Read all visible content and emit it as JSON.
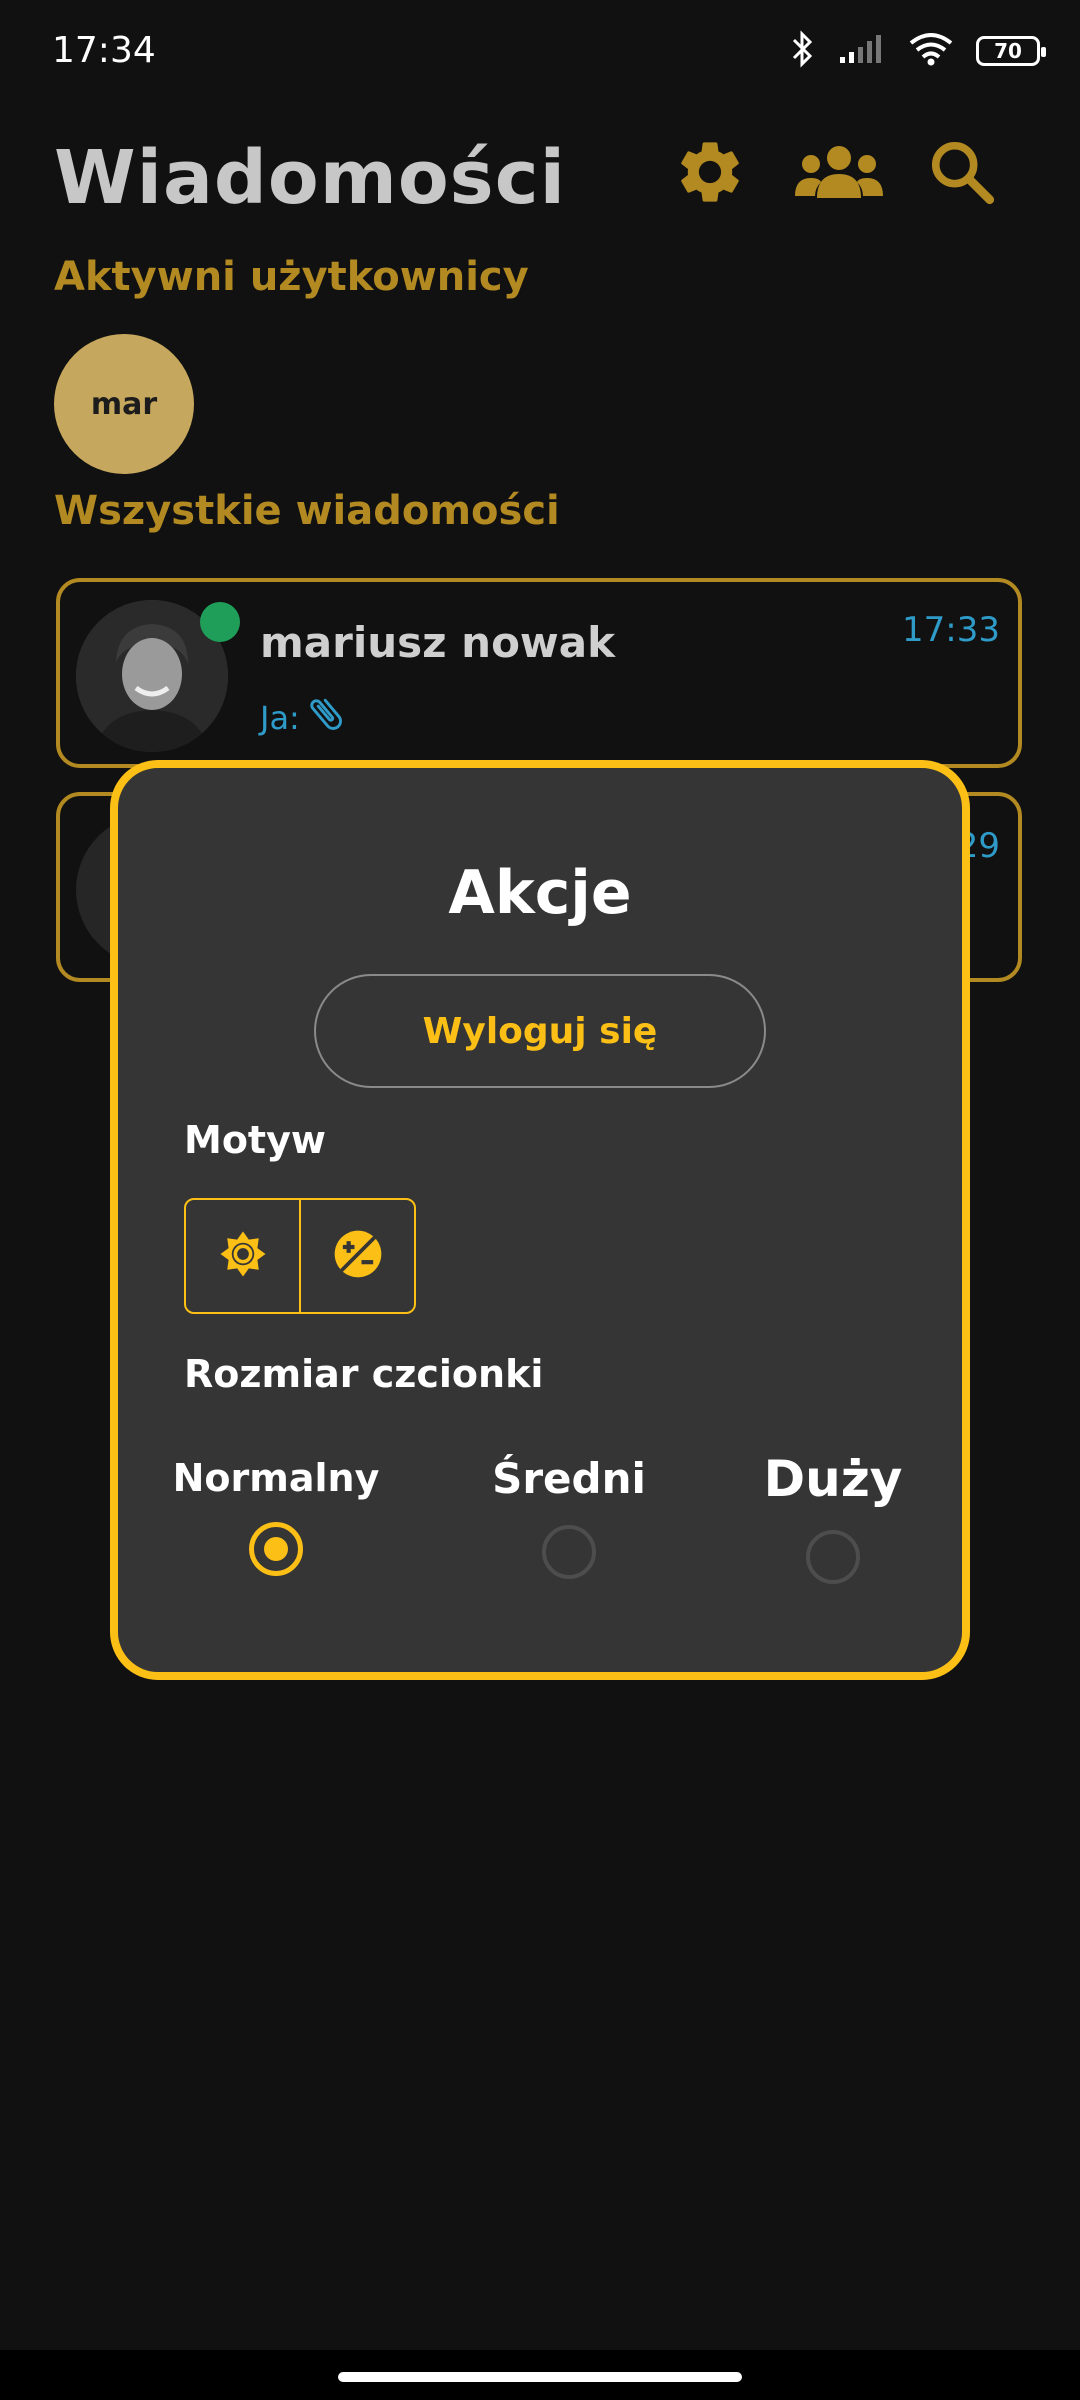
{
  "status_bar": {
    "time": "17:34",
    "battery": "70",
    "icons": [
      "bluetooth-icon",
      "signal-icon",
      "wifi-icon",
      "battery-icon"
    ]
  },
  "header": {
    "title": "Wiadomości",
    "icons": [
      "settings-gear-icon",
      "users-group-icon",
      "search-icon"
    ]
  },
  "active_users": {
    "title": "Aktywni użytkownicy",
    "users": [
      {
        "initials": "mar"
      }
    ]
  },
  "all_messages": {
    "title": "Wszystkie wiadomości",
    "chats": [
      {
        "name": "mariusz nowak",
        "time": "17:33",
        "preview_prefix": "Ja:",
        "preview_icon": "paperclip-icon",
        "online": true
      },
      {
        "name": "",
        "time": "29",
        "preview_prefix": "",
        "online": false
      }
    ]
  },
  "actions_dialog": {
    "title": "Akcje",
    "logout_label": "Wyloguj się",
    "theme_label": "Motyw",
    "theme_options": [
      "light-theme-icon",
      "contrast-theme-icon"
    ],
    "font_size_label": "Rozmiar czcionki",
    "font_sizes": [
      {
        "label": "Normalny",
        "selected": true
      },
      {
        "label": "Średni",
        "selected": false
      },
      {
        "label": "Duży",
        "selected": false
      }
    ]
  },
  "colors": {
    "accent": "#fbbf16",
    "accent_dim": "#b38a21",
    "background": "#111111",
    "dialog_bg": "#353535",
    "link_blue": "#2e9bc9",
    "online_green": "#1f9e5a"
  }
}
